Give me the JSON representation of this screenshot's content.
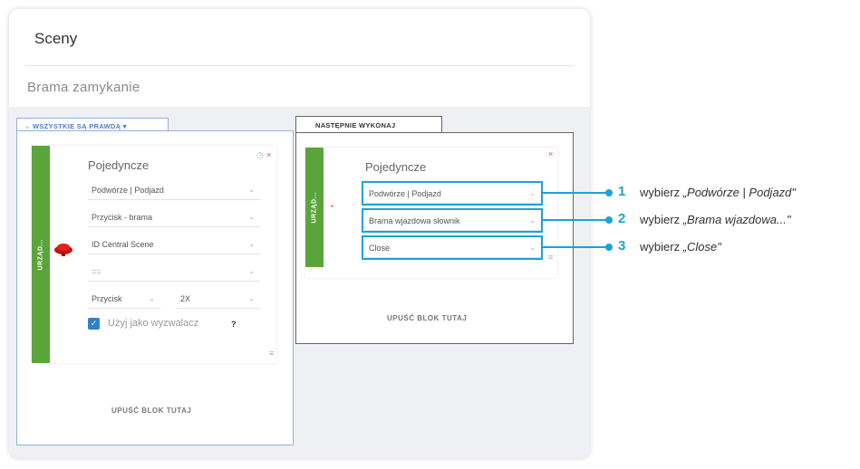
{
  "header": {
    "title": "Sceny",
    "scene_name": "Brama zamykanie"
  },
  "conditions": {
    "tab_label": "WSZYSTKIE SĄ PRAWDĄ",
    "strip_label": "URZĄD...",
    "block_title": "Pojedyncze",
    "fields": [
      "Podwórze | Podjazd",
      "Przycisk - brama",
      "ID Central Scene",
      "=="
    ],
    "button_field": "Przycisk",
    "count_field": "2X",
    "trigger_label": "Użyj jako wyzwalacz",
    "trigger_help": "?",
    "trigger_checked": true,
    "drop_label": "UPUŚĆ BLOK TUTAJ"
  },
  "actions": {
    "tab_label": "NASTĘPNIE WYKONAJ",
    "strip_label": "URZĄD...",
    "block_title": "Pojedyncze",
    "fields": [
      "Podwórze | Podjazd",
      "Brama wjazdowa słownik",
      "Close"
    ],
    "drop_label": "UPUŚĆ BLOK TUTAJ"
  },
  "annotations": [
    {
      "num": "1",
      "prefix": "wybierz ",
      "text": "„Podwórze | Podjazd\""
    },
    {
      "num": "2",
      "prefix": "wybierz ",
      "text": "„Brama wjazdowa...\""
    },
    {
      "num": "3",
      "prefix": "wybierz ",
      "text": "„Close\""
    }
  ],
  "colors": {
    "accent": "#1aa3d9",
    "strip": "#5aa53a",
    "condition_border": "#8fb3dc",
    "remove": "#e05050"
  },
  "icons": {
    "close": "close-icon",
    "timer": "timer-icon",
    "menu": "menu-icon",
    "chevron": "chevron-down-icon",
    "device": "red-button-icon"
  }
}
